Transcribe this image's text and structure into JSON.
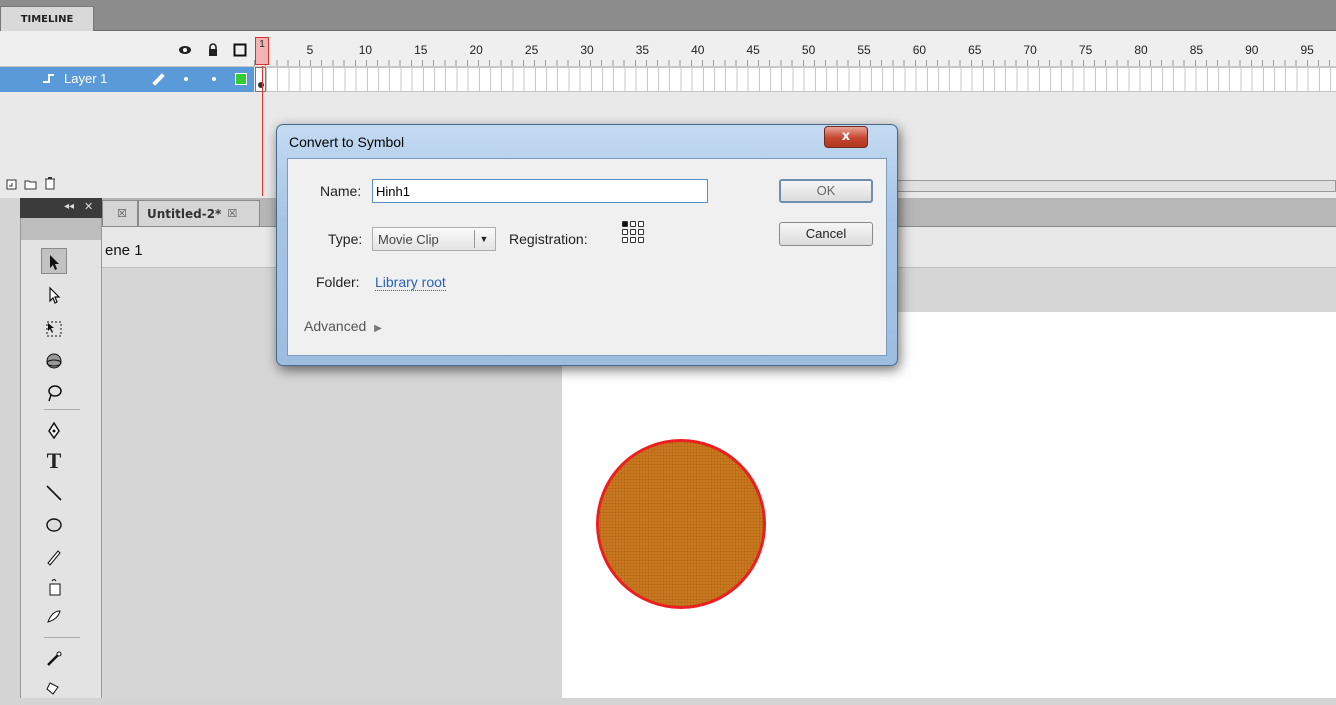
{
  "timeline": {
    "tab_label": "TIMELINE",
    "header_icons": [
      "eye-icon",
      "lock-icon",
      "outline-square-icon"
    ],
    "playhead_frame": "1",
    "frame_numbers": [
      "5",
      "10",
      "15",
      "20",
      "25",
      "30",
      "35",
      "40",
      "45",
      "50",
      "55",
      "60",
      "65",
      "70",
      "75",
      "80",
      "85",
      "90",
      "95"
    ],
    "layer": {
      "name": "Layer 1",
      "outline_color": "#33cc33"
    }
  },
  "doc_tabs": [
    {
      "label": "Untitled-2*"
    }
  ],
  "scene": {
    "label": "ene 1"
  },
  "dialog": {
    "title": "Convert to Symbol",
    "close_label": "x",
    "name_label": "Name:",
    "name_value": "Hinh1",
    "type_label": "Type:",
    "type_value": "Movie Clip",
    "registration_label": "Registration:",
    "folder_label": "Folder:",
    "folder_value": "Library root",
    "advanced_label": "Advanced",
    "ok_label": "OK",
    "cancel_label": "Cancel"
  },
  "stage": {
    "circle_fill": "#c8781e",
    "circle_stroke": "#ea2020"
  },
  "colors": {
    "layer_selected": "#5a9ad8",
    "dialog_frame": "#a9c8e8",
    "playhead": "#e03030"
  }
}
